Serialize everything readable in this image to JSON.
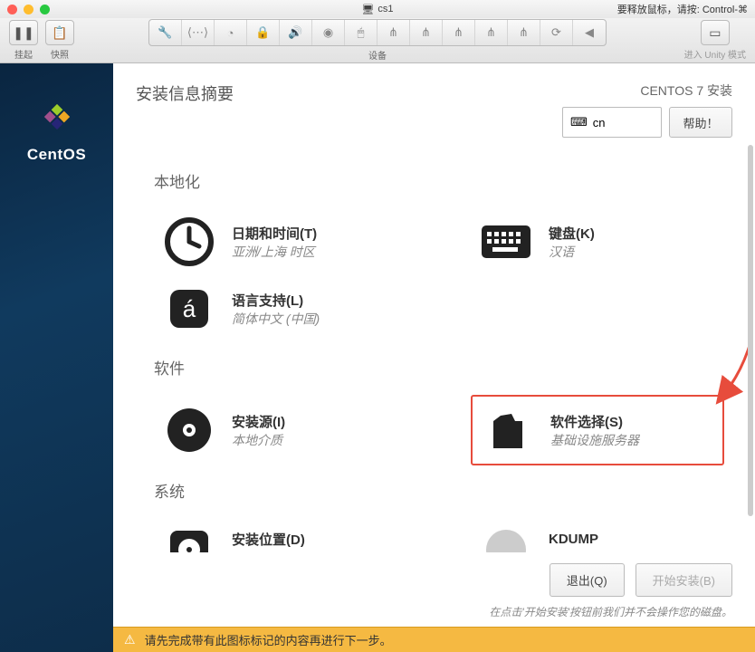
{
  "titlebar": {
    "vm_name": "cs1",
    "right_hint": "要释放鼠标，请按: Control-⌘"
  },
  "vm_toolbar": {
    "suspend_label": "挂起",
    "snapshot_label": "快照",
    "devices_label": "设备",
    "unity_label": "进入 Unity 模式"
  },
  "sidebar": {
    "brand": "CentOS"
  },
  "header": {
    "title": "安装信息摘要",
    "subtitle": "CENTOS 7 安装",
    "lang_code": "cn",
    "help_label": "帮助！"
  },
  "sections": {
    "localization": {
      "title": "本地化",
      "datetime": {
        "title": "日期和时间(T)",
        "sub": "亚洲/上海 时区"
      },
      "keyboard": {
        "title": "键盘(K)",
        "sub": "汉语"
      },
      "language": {
        "title": "语言支持(L)",
        "sub": "简体中文 (中国)"
      }
    },
    "software": {
      "title": "软件",
      "source": {
        "title": "安装源(I)",
        "sub": "本地介质"
      },
      "selection": {
        "title": "软件选择(S)",
        "sub": "基础设施服务器"
      }
    },
    "system": {
      "title": "系统",
      "destination": {
        "title": "安装位置(D)",
        "sub": ""
      },
      "kdump": {
        "title": "KDUMP",
        "sub": ""
      }
    }
  },
  "footer": {
    "quit": "退出(Q)",
    "begin": "开始安装(B)",
    "hint": "在点击'开始安装'按钮前我们并不会操作您的磁盘。"
  },
  "warning": {
    "text": "请先完成带有此图标标记的内容再进行下一步。"
  }
}
